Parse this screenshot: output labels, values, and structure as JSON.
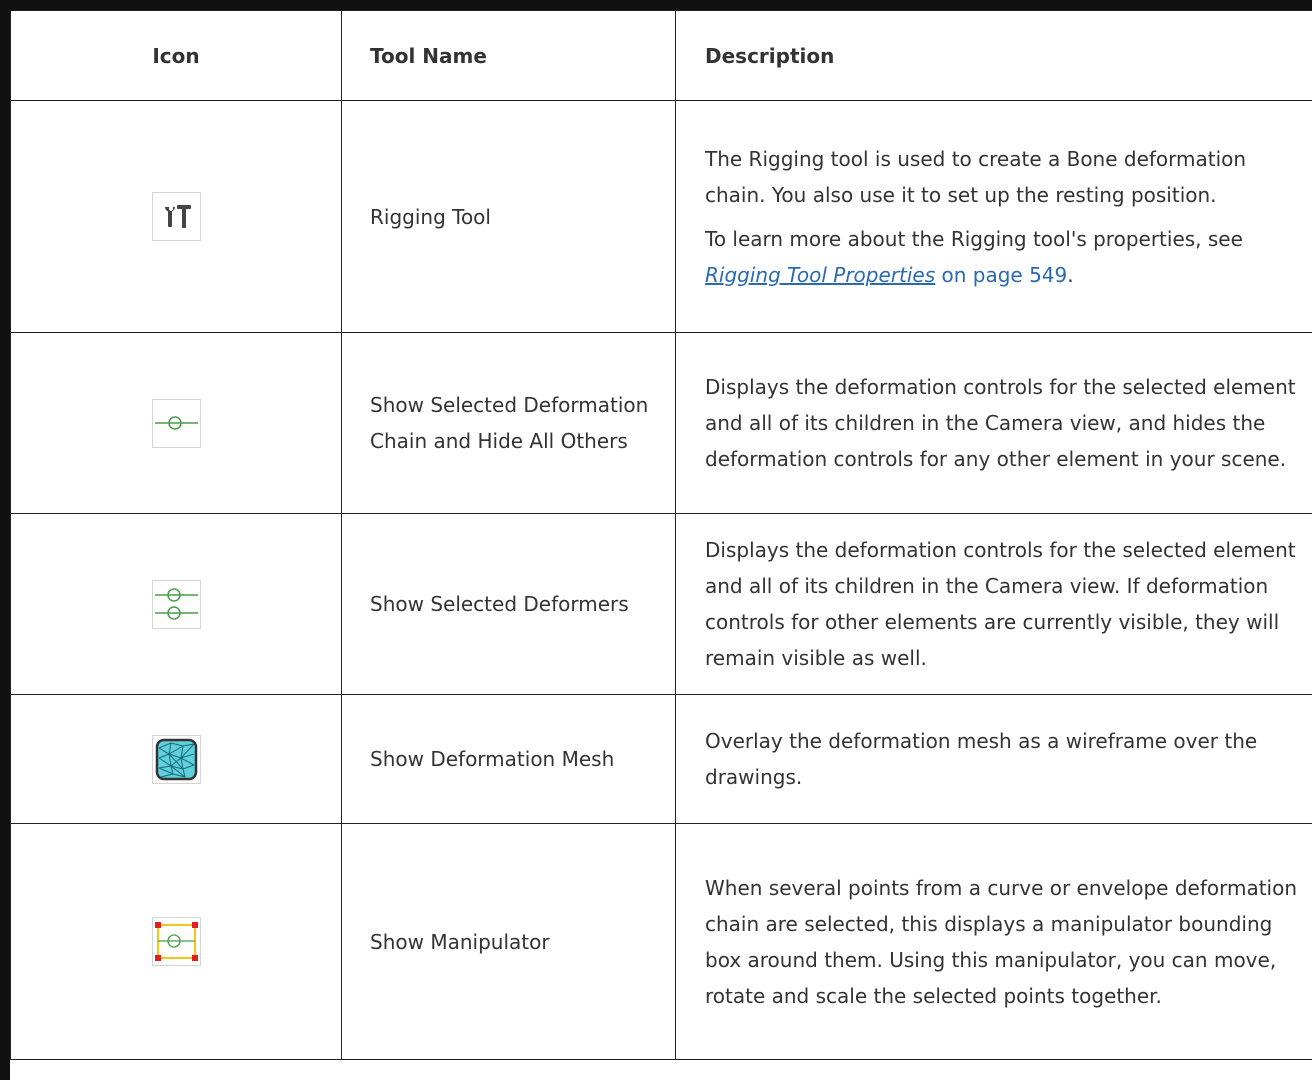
{
  "table": {
    "headers": {
      "icon": "Icon",
      "tool_name": "Tool Name",
      "description": "Description"
    },
    "rows": [
      {
        "icon": "rigging-tool-icon",
        "tool_name": "Rigging Tool",
        "description_1": "The Rigging tool is used to create a Bone deformation chain. You also use it to set up the resting position.",
        "description_2_prefix": "To learn more about the Rigging tool's properties, see ",
        "link_text": "Rigging Tool Properties",
        "page_ref": " on page 549",
        "description_2_suffix": "."
      },
      {
        "icon": "show-selected-chain-icon",
        "tool_name": "Show Selected Deformation Chain and Hide All Others",
        "description_1": "Displays the deformation controls for the selected element and all of its children in the Camera view, and hides the deformation controls for any other element in your scene."
      },
      {
        "icon": "show-selected-deformers-icon",
        "tool_name": "Show Selected Deformers",
        "description_1": "Displays the deformation controls for the selected element and all of its children in the Camera view. If deformation controls for other elements are currently visible, they will remain visible as well."
      },
      {
        "icon": "deformation-mesh-icon",
        "tool_name": "Show Deformation Mesh",
        "description_1": "Overlay the deformation mesh as a wireframe over the drawings."
      },
      {
        "icon": "manipulator-icon",
        "tool_name": "Show Manipulator",
        "description_1": "When several points from a curve or envelope deformation chain are selected, this displays a manipulator bounding box around them. Using this manipulator, you can move, rotate and scale the selected points together."
      }
    ]
  },
  "colors": {
    "border": "#222222",
    "text": "#333333",
    "link": "#2a6ab0",
    "deformer_green": "#4a9e4a",
    "mesh_teal": "#2ab0c0",
    "manipulator_yellow": "#f5c518",
    "manipulator_red": "#e02020"
  }
}
